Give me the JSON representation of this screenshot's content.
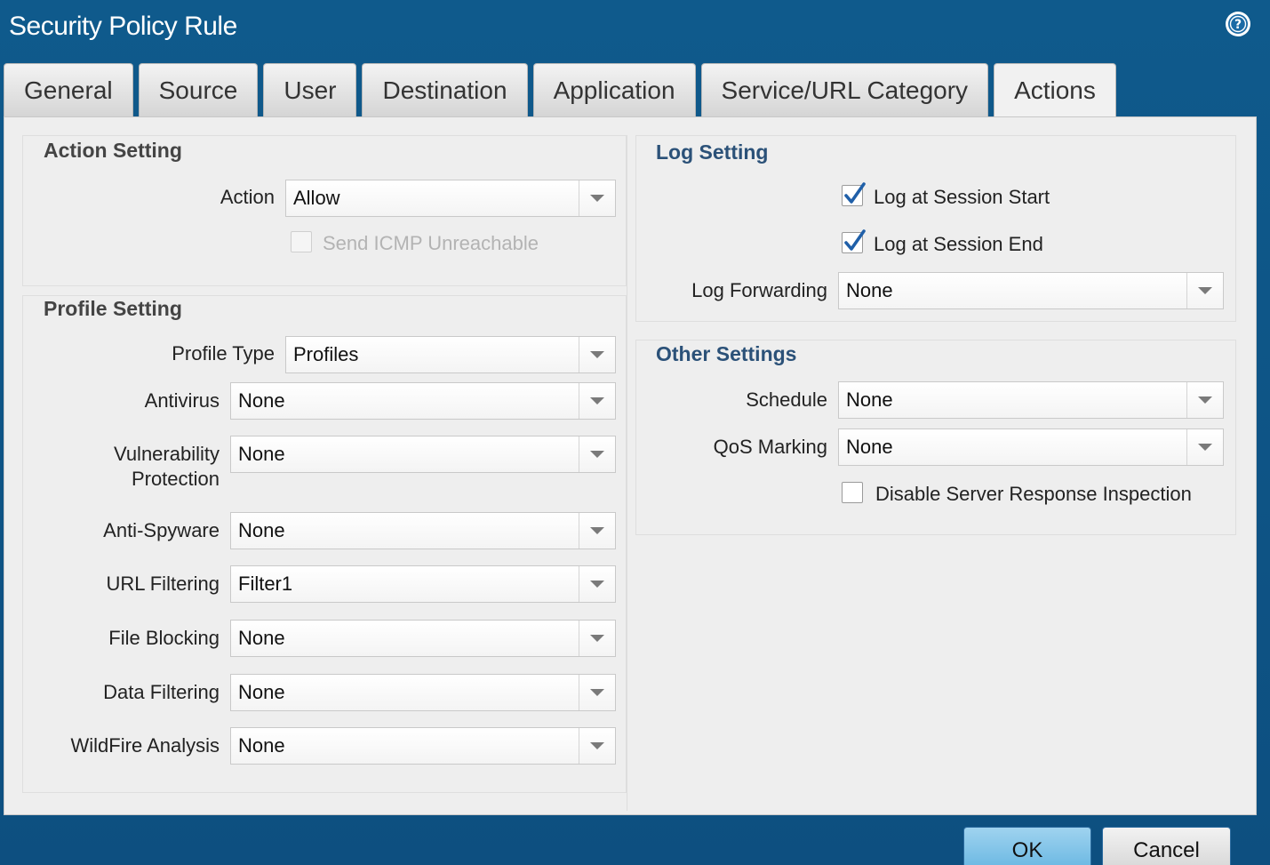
{
  "window": {
    "title": "Security Policy Rule",
    "help_icon": "help-circle-icon"
  },
  "tabs": [
    {
      "label": "General",
      "active": false
    },
    {
      "label": "Source",
      "active": false
    },
    {
      "label": "User",
      "active": false
    },
    {
      "label": "Destination",
      "active": false
    },
    {
      "label": "Application",
      "active": false
    },
    {
      "label": "Service/URL Category",
      "active": false
    },
    {
      "label": "Actions",
      "active": true
    }
  ],
  "action_setting": {
    "title": "Action Setting",
    "action_label": "Action",
    "action_value": "Allow",
    "send_icmp_label": "Send ICMP Unreachable",
    "send_icmp_checked": false
  },
  "profile_setting": {
    "title": "Profile Setting",
    "profile_type_label": "Profile Type",
    "profile_type_value": "Profiles",
    "antivirus_label": "Antivirus",
    "antivirus_value": "None",
    "vulnerability_label_1": "Vulnerability",
    "vulnerability_label_2": "Protection",
    "vulnerability_value": "None",
    "antispyware_label": "Anti-Spyware",
    "antispyware_value": "None",
    "url_filtering_label": "URL Filtering",
    "url_filtering_value": "Filter1",
    "file_blocking_label": "File Blocking",
    "file_blocking_value": "None",
    "data_filtering_label": "Data Filtering",
    "data_filtering_value": "None",
    "wildfire_label": "WildFire Analysis",
    "wildfire_value": "None"
  },
  "log_setting": {
    "title": "Log Setting",
    "log_start_label": "Log at Session Start",
    "log_start_checked": true,
    "log_end_label": "Log at Session End",
    "log_end_checked": true,
    "log_forwarding_label": "Log Forwarding",
    "log_forwarding_value": "None"
  },
  "other_settings": {
    "title": "Other Settings",
    "schedule_label": "Schedule",
    "schedule_value": "None",
    "qos_label": "QoS Marking",
    "qos_value": "None",
    "dsri_label": "Disable Server Response Inspection",
    "dsri_checked": false
  },
  "buttons": {
    "ok": "OK",
    "cancel": "Cancel"
  }
}
